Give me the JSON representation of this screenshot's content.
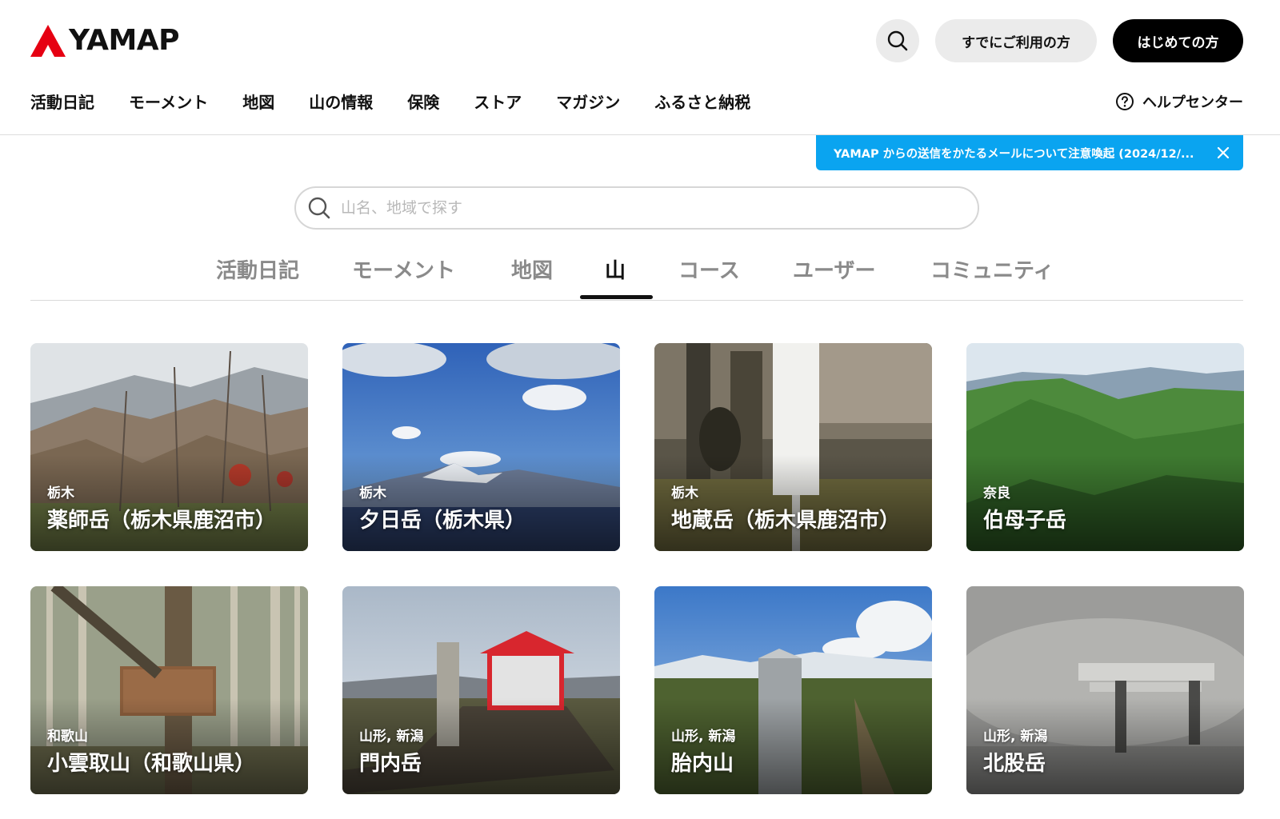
{
  "brand": {
    "name": "YAMAP",
    "accent": "#e60012"
  },
  "header": {
    "search_icon": "search-icon",
    "login_label": "すでにご利用の方",
    "signup_label": "はじめての方"
  },
  "nav": {
    "items": [
      "活動日記",
      "モーメント",
      "地図",
      "山の情報",
      "保険",
      "ストア",
      "マガジン",
      "ふるさと納税"
    ],
    "help_label": "ヘルプセンター"
  },
  "notice": {
    "text": "YAMAP からの送信をかたるメールについて注意喚起 (2024/12/...",
    "color": "#0aa4f0"
  },
  "search": {
    "placeholder": "山名、地域で探す"
  },
  "tabs": {
    "items": [
      "活動日記",
      "モーメント",
      "地図",
      "山",
      "コース",
      "ユーザー",
      "コミュニティ"
    ],
    "active": "山"
  },
  "mountains": [
    {
      "pref": "栃木",
      "name": "薬師岳（栃木県鹿沼市）"
    },
    {
      "pref": "栃木",
      "name": "夕日岳（栃木県）"
    },
    {
      "pref": "栃木",
      "name": "地蔵岳（栃木県鹿沼市）"
    },
    {
      "pref": "奈良",
      "name": "伯母子岳"
    },
    {
      "pref": "和歌山",
      "name": "小雲取山（和歌山県）"
    },
    {
      "pref": "山形, 新潟",
      "name": "門内岳"
    },
    {
      "pref": "山形, 新潟",
      "name": "胎内山"
    },
    {
      "pref": "山形, 新潟",
      "name": "北股岳"
    }
  ]
}
